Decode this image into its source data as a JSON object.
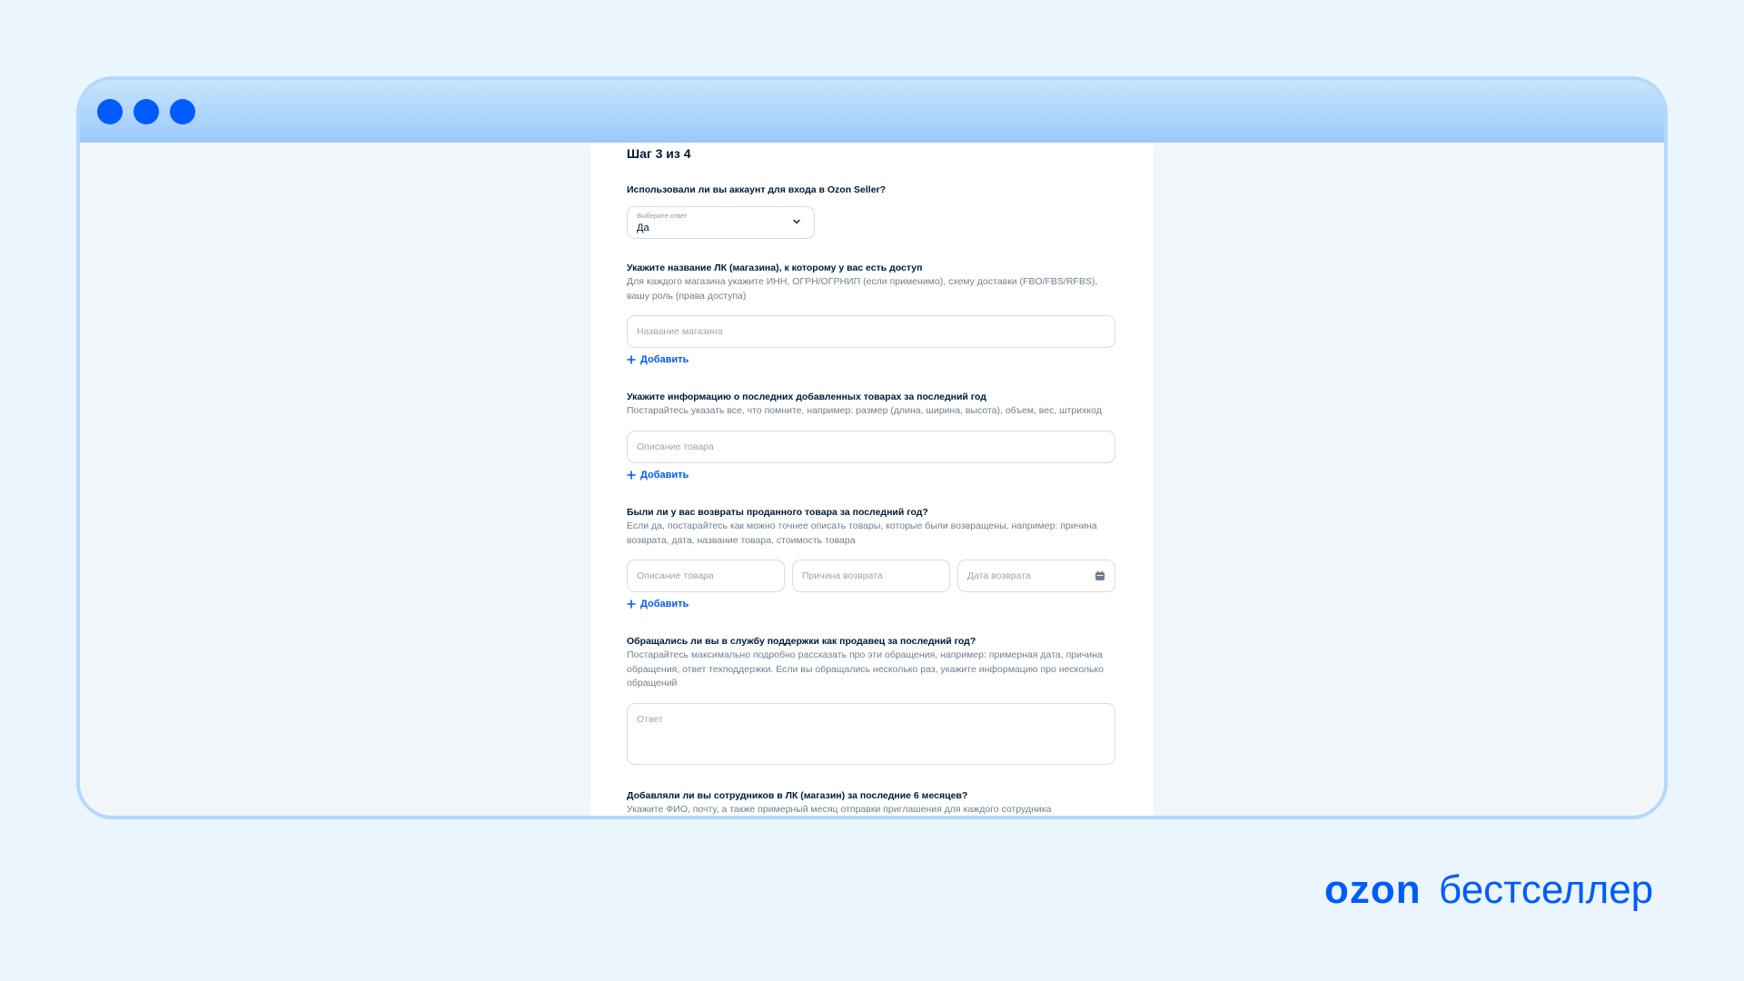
{
  "window": {
    "dots": [
      "dot",
      "dot",
      "dot"
    ]
  },
  "form": {
    "step": "Шаг 3 из 4",
    "q1": {
      "label": "Использовали ли вы аккаунт для входа в Ozon Seller?",
      "select_caption": "Выберите ответ",
      "select_value": "Да",
      "icon": "chevron-down-icon"
    },
    "q2": {
      "label": "Укажите название ЛК (магазина), к которому у вас есть доступ",
      "hint_line1": "Для каждого магазина укажите ИНН, ОГРН/ОГРНИП (если применимо), схему доставки (FBO/FBS/RFBS),",
      "hint_line2": "вашу роль (права доступа)",
      "placeholder": "Название магазина",
      "add_label": "Добавить"
    },
    "q3": {
      "label": "Укажите информацию о последних добавленных товарах за последний год",
      "hint": "Постарайтесь указать все, что помните, например: размер (длина, ширина, высота), объем, вес, штрихкод",
      "placeholder": "Описание товара",
      "add_label": "Добавить"
    },
    "q4": {
      "label": "Были ли у вас возвраты проданного товара за последний год?",
      "hint_line1": "Если да, постарайтесь как можно точнее описать товары, которые были возвращены, например: причина",
      "hint_line2": "возврата, дата, название товара, стоимость товара",
      "placeholder_item": "Описание товара",
      "placeholder_reason": "Причина возврата",
      "placeholder_date": "Дата возврата",
      "date_icon": "calendar-icon",
      "add_label": "Добавить"
    },
    "q5": {
      "label": "Обращались ли вы в службу поддержки как продавец за последний год?",
      "hint_line1": "Постарайтесь максимально подробно рассказать про эти обращения, например: примерная дата, причина",
      "hint_line2": "обращения, ответ техподдержки. Если вы обращались несколько раз, укажите информацию про несколько",
      "hint_line3": "обращений",
      "placeholder": "Ответ"
    },
    "q6": {
      "label": "Добавляли ли вы сотрудников в ЛК (магазин) за последние 6 месяцев?",
      "hint": "Укажите ФИО, почту, а также примерный месяц отправки приглашения для каждого сотрудника"
    }
  },
  "brand": {
    "logo": "ozon бестселлер",
    "color": "#005bff"
  },
  "colors": {
    "accent": "#005bff",
    "background": "#eaf5fe",
    "window_border": "#b4d8fb"
  }
}
